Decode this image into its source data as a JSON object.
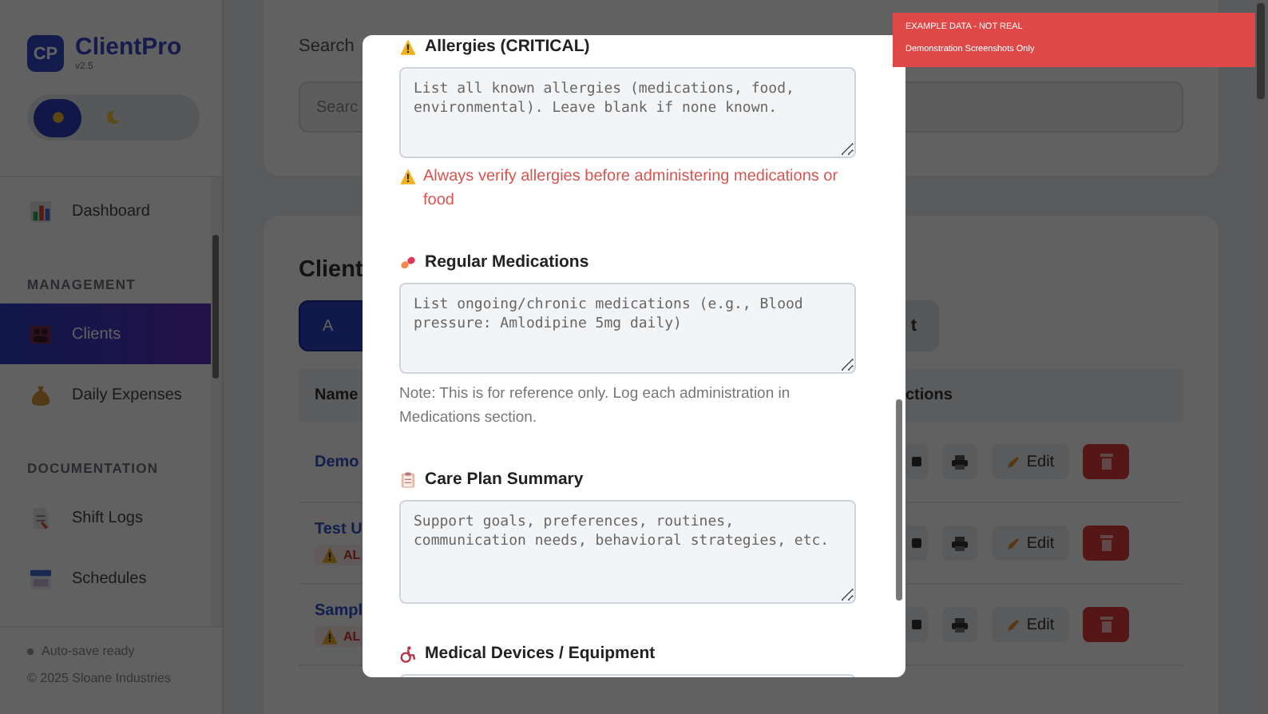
{
  "banner": {
    "title": "EXAMPLE DATA - NOT REAL",
    "subtitle": "Demonstration Screenshots Only"
  },
  "sidebar": {
    "logo": "CP",
    "app_name": "ClientPro",
    "version": "v2.5",
    "theme_toggle": [
      {
        "kind": "light",
        "selected": true
      },
      {
        "kind": "dark",
        "selected": false
      }
    ],
    "sections": [
      {
        "items": [
          {
            "label": "Dashboard",
            "selected": false
          }
        ]
      },
      {
        "title": "MANAGEMENT",
        "items": [
          {
            "label": "Clients",
            "selected": true
          },
          {
            "label": "Daily Expenses",
            "selected": false
          }
        ]
      },
      {
        "title": "DOCUMENTATION",
        "items": [
          {
            "label": "Shift Logs",
            "selected": false
          },
          {
            "label": "Schedules",
            "selected": false
          }
        ]
      }
    ],
    "status": "Auto-save ready",
    "copyright": "© 2025 Sloane Industries"
  },
  "search_card": {
    "label": "Search",
    "placeholder": "Searc"
  },
  "clients_card": {
    "title": "Client",
    "add_button": "A",
    "right_button": "t",
    "columns": [
      "Name",
      "ctions"
    ],
    "rows": [
      {
        "name": "Demo",
        "edit": "Edit"
      },
      {
        "name": "Test U",
        "badge": "AL",
        "edit": "Edit"
      },
      {
        "name": "Sampl",
        "badge": "AL",
        "edit": "Edit"
      }
    ]
  },
  "modal": {
    "fields": [
      {
        "label": "Allergies (CRITICAL)",
        "placeholder": "List all known allergies (medications, food, environmental). Leave blank if none known.",
        "warning": "Always verify allergies before administering medications or food"
      },
      {
        "label": "Regular Medications",
        "placeholder": "List ongoing/chronic medications (e.g., Blood pressure: Amlodipine 5mg daily)",
        "note": "Note: This is for reference only. Log each administration in Medications section."
      },
      {
        "label": "Care Plan Summary",
        "placeholder": "Support goals, preferences, routines, communication needs, behavioral strategies, etc."
      },
      {
        "label": "Medical Devices / Equipment"
      }
    ]
  }
}
